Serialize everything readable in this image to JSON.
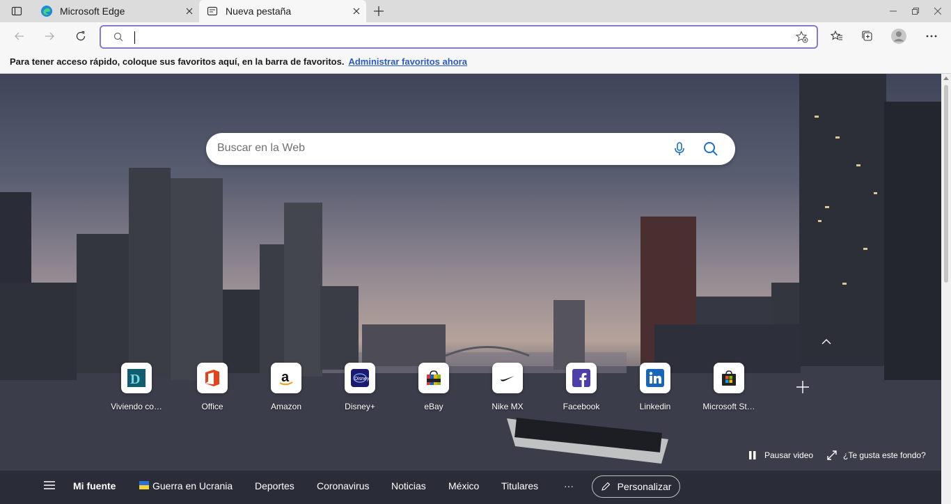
{
  "tabs": [
    {
      "title": "Microsoft Edge",
      "icon": "edge-icon"
    },
    {
      "title": "Nueva pestaña",
      "icon": "new-tab-page-icon"
    }
  ],
  "address": {
    "value": "",
    "placeholder": ""
  },
  "favorites_bar": {
    "message": "Para tener acceso rápido, coloque sus favoritos aquí, en la barra de favoritos.",
    "link": "Administrar favoritos ahora"
  },
  "search": {
    "placeholder": "Buscar en la Web"
  },
  "quick_links": [
    {
      "label": "Viviendo co…",
      "icon": "viviendo-icon"
    },
    {
      "label": "Office",
      "icon": "office-icon"
    },
    {
      "label": "Amazon",
      "icon": "amazon-icon"
    },
    {
      "label": "Disney+",
      "icon": "disney-icon"
    },
    {
      "label": "eBay",
      "icon": "ebay-icon"
    },
    {
      "label": "Nike MX",
      "icon": "nike-icon"
    },
    {
      "label": "Facebook",
      "icon": "facebook-icon"
    },
    {
      "label": "Linkedin",
      "icon": "linkedin-icon"
    },
    {
      "label": "Microsoft St…",
      "icon": "microsoft-store-icon"
    }
  ],
  "video_controls": {
    "pause": "Pausar video",
    "like_bg": "¿Te gusta este fondo?"
  },
  "feed": {
    "my_feed": "Mi fuente",
    "items": [
      "Guerra en Ucrania",
      "Deportes",
      "Coronavirus",
      "Noticias",
      "México",
      "Titulares"
    ],
    "more": "···",
    "customize": "Personalizar"
  },
  "colors": {
    "accent": "#8c78c8",
    "link": "#2a5bbf"
  }
}
